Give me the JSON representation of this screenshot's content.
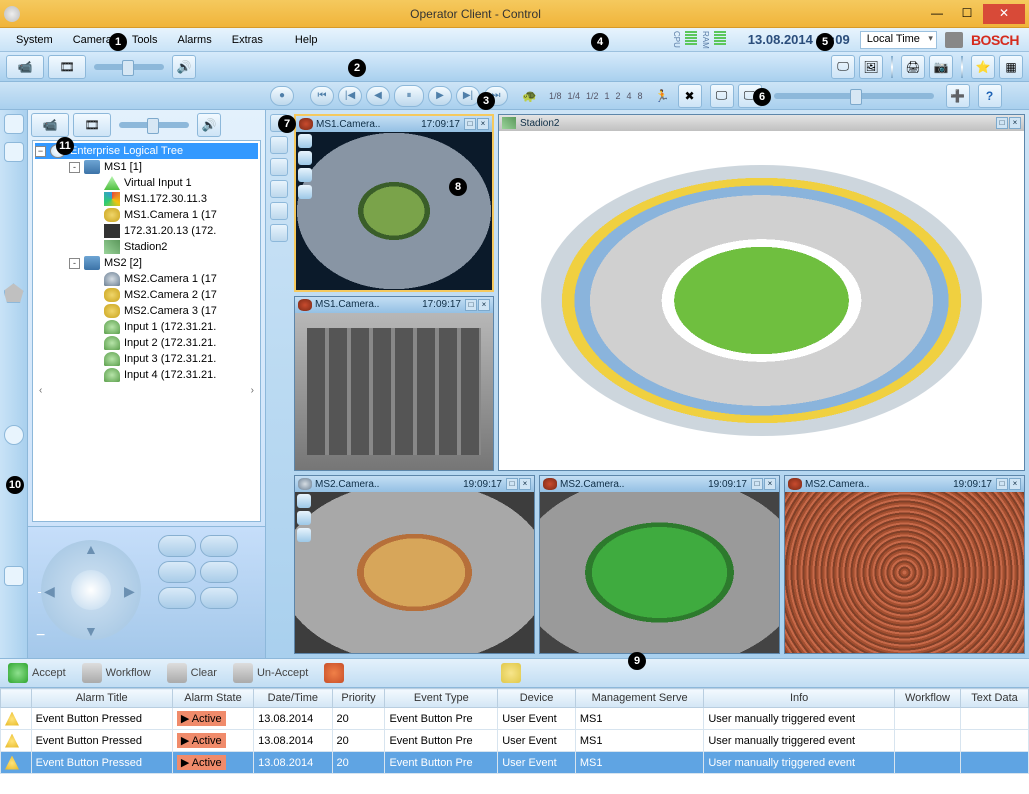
{
  "window": {
    "title": "Operator Client - Control"
  },
  "menu": {
    "items": [
      "System",
      "Camera",
      "Tools",
      "Alarms",
      "Extras",
      "Help"
    ]
  },
  "header": {
    "datetime": "13.08.2014 17:09",
    "timezone": "Local Time",
    "cpu_label": "CPU",
    "ram_label": "RAM",
    "logo": "BOSCH"
  },
  "tree": {
    "root": "Enterprise Logical Tree",
    "nodes": [
      {
        "lvl": 2,
        "exp": "-",
        "icon": "server",
        "label": "MS1 [1]"
      },
      {
        "lvl": 3,
        "icon": "virtual",
        "label": "Virtual Input 1"
      },
      {
        "lvl": 3,
        "icon": "disk",
        "label": "MS1.172.30.11.3"
      },
      {
        "lvl": 3,
        "icon": "cam",
        "label": "MS1.Camera 1 (17"
      },
      {
        "lvl": 3,
        "icon": "iscsi",
        "label": "172.31.20.13 (172."
      },
      {
        "lvl": 3,
        "icon": "map",
        "label": "Stadion2"
      },
      {
        "lvl": 2,
        "exp": "-",
        "icon": "server",
        "label": "MS2 [2]"
      },
      {
        "lvl": 3,
        "icon": "dome",
        "label": "MS2.Camera 1 (17"
      },
      {
        "lvl": 3,
        "icon": "cam",
        "label": "MS2.Camera 2 (17"
      },
      {
        "lvl": 3,
        "icon": "cam",
        "label": "MS2.Camera 3 (17"
      },
      {
        "lvl": 3,
        "icon": "input",
        "label": "Input 1 (172.31.21."
      },
      {
        "lvl": 3,
        "icon": "input",
        "label": "Input 2 (172.31.21."
      },
      {
        "lvl": 3,
        "icon": "input",
        "label": "Input 3 (172.31.21."
      },
      {
        "lvl": 3,
        "icon": "input",
        "label": "Input 4 (172.31.21."
      }
    ]
  },
  "speed_marks": [
    "1/8",
    "1/4",
    "1/2",
    "1",
    "2",
    "4",
    "8"
  ],
  "panes": [
    {
      "name": "MS1.Camera..",
      "time": "17:09:17",
      "scene": "night-stadium",
      "selected": true
    },
    {
      "name": "Stadion2",
      "time": "",
      "scene": "map",
      "map": true
    },
    {
      "name": "MS1.Camera..",
      "time": "17:09:17",
      "scene": "parking"
    },
    {
      "name": "MS2.Camera..",
      "time": "19:09:17",
      "scene": "arena"
    },
    {
      "name": "MS2.Camera..",
      "time": "19:09:17",
      "scene": "field"
    },
    {
      "name": "MS2.Camera..",
      "time": "19:09:17",
      "scene": "crowd"
    }
  ],
  "alarm_actions": {
    "accept": "Accept",
    "workflow": "Workflow",
    "clear": "Clear",
    "unaccept": "Un-Accept"
  },
  "alarm_columns": [
    "",
    "Alarm Title",
    "Alarm State",
    "Date/Time",
    "Priority",
    "Event Type",
    "Device",
    "Management Serve",
    "Info",
    "Workflow",
    "Text Data"
  ],
  "alarms": [
    {
      "title": "Event Button Pressed",
      "state": "Active",
      "dt": "13.08.2014",
      "prio": "20",
      "et": "Event Button Pre",
      "dev": "User Event",
      "ms": "MS1",
      "info": "User manually triggered event"
    },
    {
      "title": "Event Button Pressed",
      "state": "Active",
      "dt": "13.08.2014",
      "prio": "20",
      "et": "Event Button Pre",
      "dev": "User Event",
      "ms": "MS1",
      "info": "User manually triggered event"
    },
    {
      "title": "Event Button Pressed",
      "state": "Active",
      "dt": "13.08.2014",
      "prio": "20",
      "et": "Event Button Pre",
      "dev": "User Event",
      "ms": "MS1",
      "info": "User manually triggered event",
      "sel": true
    }
  ],
  "callouts": {
    "1": "1",
    "2": "2",
    "3": "3",
    "4": "4",
    "5": "5",
    "6": "6",
    "7": "7",
    "8": "8",
    "9": "9",
    "10": "10",
    "11": "11"
  }
}
